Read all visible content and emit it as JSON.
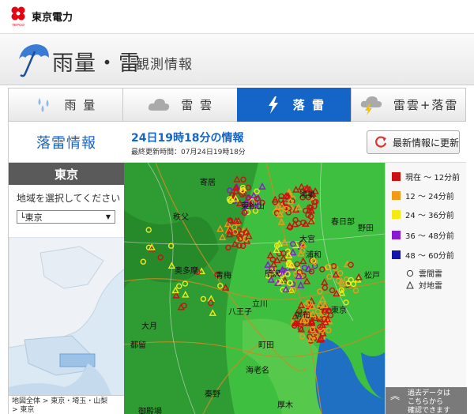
{
  "brand": {
    "name": "東京電力",
    "logo_text": "TEPCO"
  },
  "header": {
    "title": "雨量・雷",
    "subtitle": "観測情報"
  },
  "tabs": [
    {
      "label": "雨 量",
      "icon": "raindrops-icon",
      "active": false
    },
    {
      "label": "雷 雲",
      "icon": "cloud-icon",
      "active": false
    },
    {
      "label": "落 雷",
      "icon": "lightning-icon",
      "active": true
    },
    {
      "label": "雷雲+落雷",
      "icon": "storm-cloud-icon",
      "active": false
    }
  ],
  "sidebar": {
    "section_title": "落雷情報",
    "region_name": "東京",
    "region_prompt": "地域を選択してください",
    "region_selected": "└東京",
    "breadcrumb_line1": "地図全体 > 東京・埼玉・山梨",
    "breadcrumb_line2": "> 東京"
  },
  "info": {
    "title": "24日19時18分の情報",
    "updated": "最終更新時間：07月24日19時18分",
    "refresh_label": "最新情報に更新"
  },
  "legend": {
    "items": [
      {
        "label": "現在 ～ 12分前",
        "color": "#cc1111"
      },
      {
        "label": "12 ～ 24分前",
        "color": "#f29a16"
      },
      {
        "label": "24 ～ 36分前",
        "color": "#f2ea12"
      },
      {
        "label": "36 ～ 48分前",
        "color": "#8a1ad1"
      },
      {
        "label": "48 ～ 60分前",
        "color": "#1414a8"
      }
    ],
    "cloud_lightning": "雲間雷",
    "ground_lightning": "対地雷",
    "past_data_line1": "過去データは",
    "past_data_line2": "こちらから",
    "past_data_line3": "確認できます"
  },
  "map_labels": [
    "寄居",
    "秩父",
    "東松山",
    "鴻巣",
    "大宮",
    "春日部",
    "野田",
    "浦和",
    "奥多摩",
    "青梅",
    "所沢",
    "松戸",
    "立川",
    "八王子",
    "調布",
    "東京",
    "大月",
    "都留",
    "町田",
    "海老名",
    "秦野",
    "御殿場",
    "厚木"
  ]
}
